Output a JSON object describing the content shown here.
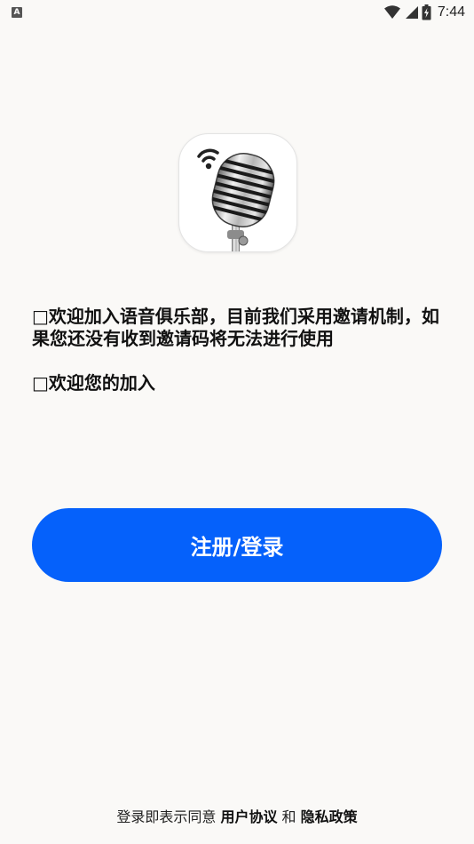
{
  "status_bar": {
    "notification_badge": "A",
    "time": "7:44",
    "icons": [
      "wifi-icon",
      "signal-icon",
      "battery-charging-icon"
    ]
  },
  "logo": {
    "icon": "microphone-icon"
  },
  "intro": {
    "message": "□欢迎加入语音俱乐部，目前我们采用邀请机制，如果您还没有收到邀请码将无法进行使用",
    "welcome": "□欢迎您的加入"
  },
  "actions": {
    "register_login": "注册/登录"
  },
  "footer": {
    "agree_prefix": "登录即表示同意",
    "user_agreement": "用户协议",
    "conjunction": "和",
    "privacy_policy": "隐私政策"
  },
  "colors": {
    "primary": "#0561fb",
    "background": "#faf9f7"
  }
}
